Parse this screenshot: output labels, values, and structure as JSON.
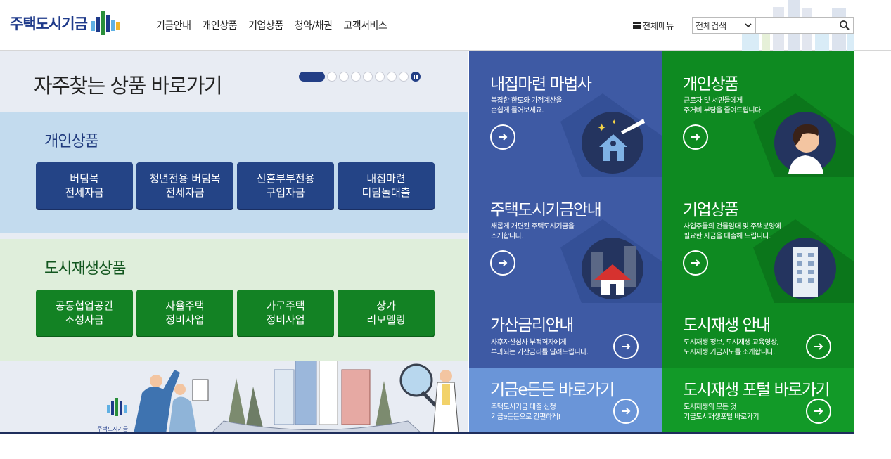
{
  "header": {
    "logo_text": "주택도시기금",
    "nav": [
      "기금안내",
      "개인상품",
      "기업상품",
      "청약/채권",
      "고객서비스"
    ],
    "all_menu_label": "전체메뉴",
    "search_select": "전체검색"
  },
  "hero": {
    "title": "자주찾는 상품 바로가기",
    "pager_count": 8
  },
  "personal": {
    "title": "개인상품",
    "buttons": [
      "버팀목\n전세자금",
      "청년전용 버팀목\n전세자금",
      "신혼부부전용\n구입자금",
      "내집마련\n디딤돌대출"
    ]
  },
  "urban": {
    "title": "도시재생상품",
    "buttons": [
      "공동협업공간\n조성자금",
      "자율주택\n정비사업",
      "가로주택\n정비사업",
      "상가\n리모델링"
    ]
  },
  "illustration": {
    "logo_text": "주택도시기금"
  },
  "tiles": [
    {
      "title": "내집마련 마법사",
      "desc": "복잡한 한도와 가점계산을\n손쉽게 풀어보세요."
    },
    {
      "title": "개인상품",
      "desc": "근로자 및 서민들에게\n주거비 부담을 줄여드립니다."
    },
    {
      "title": "주택도시기금안내",
      "desc": "새롭게 개편된 주택도시기금을\n소개합니다."
    },
    {
      "title": "기업상품",
      "desc": "사업주들의 건물임대 및 주택분양에\n필요한 자금을 대출해 드립니다."
    },
    {
      "title": "가산금리안내",
      "desc": "사후자산심사 부적격자에게\n부과되는 가산금리를 알려드립니다."
    },
    {
      "title": "도시재생 안내",
      "desc": "도시재생 정보, 도시재생 교육영상,\n도시재생 기금지도를 소개합니다."
    },
    {
      "title": "기금e든든 바로가기",
      "desc": "주택도시기금 대출 신청\n기금e든든으로 간편하게!"
    },
    {
      "title": "도시재생 포털 바로가기",
      "desc": "도시재생의 모든 것\n기금도시재생포털 바로가기"
    }
  ],
  "colors": {
    "navy": "#233f86",
    "green": "#0e8a21",
    "tile_blue": "#3e5aa4",
    "tile_lightblue": "#6a95d8"
  }
}
